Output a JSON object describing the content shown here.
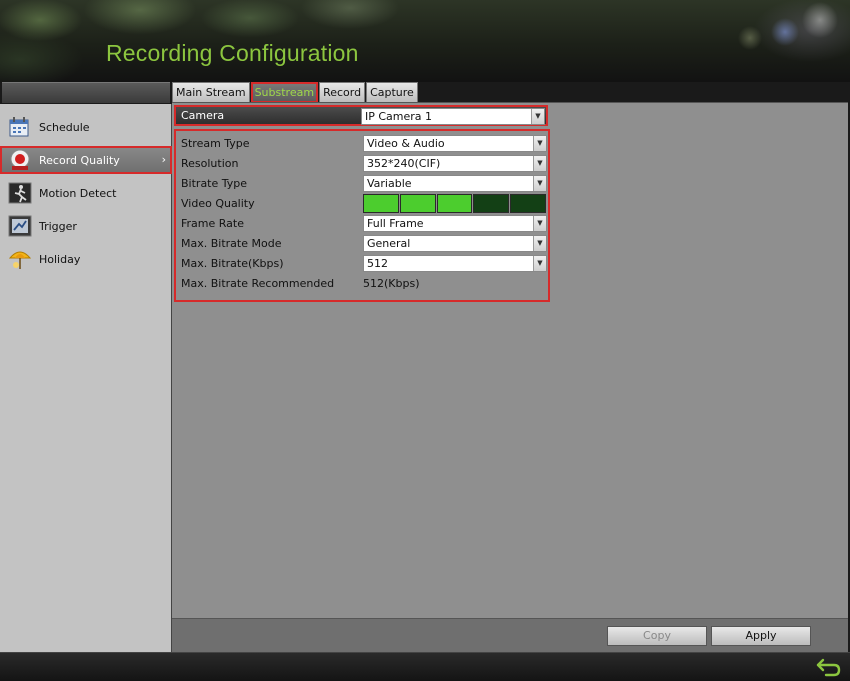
{
  "header": {
    "title": "Recording Configuration"
  },
  "tabs": [
    {
      "label": "Main Stream",
      "active": false
    },
    {
      "label": "Substream",
      "active": true
    },
    {
      "label": "Record",
      "active": false
    },
    {
      "label": "Capture",
      "active": false
    }
  ],
  "sidebar": {
    "items": [
      {
        "label": "Schedule",
        "icon": "calendar-icon",
        "active": false
      },
      {
        "label": "Record Quality",
        "icon": "record-icon",
        "active": true
      },
      {
        "label": "Motion Detect",
        "icon": "motion-icon",
        "active": false
      },
      {
        "label": "Trigger",
        "icon": "trigger-icon",
        "active": false
      },
      {
        "label": "Holiday",
        "icon": "holiday-icon",
        "active": false
      }
    ]
  },
  "camera": {
    "label": "Camera",
    "value": "IP Camera 1"
  },
  "settings": {
    "stream_type": {
      "label": "Stream Type",
      "value": "Video & Audio"
    },
    "resolution": {
      "label": "Resolution",
      "value": "352*240(CIF)"
    },
    "bitrate_type": {
      "label": "Bitrate Type",
      "value": "Variable"
    },
    "video_quality": {
      "label": "Video Quality",
      "level": 3,
      "max": 5
    },
    "frame_rate": {
      "label": "Frame Rate",
      "value": "Full Frame"
    },
    "max_bitrate_mode": {
      "label": "Max. Bitrate Mode",
      "value": "General"
    },
    "max_bitrate": {
      "label": "Max. Bitrate(Kbps)",
      "value": "512"
    },
    "max_bitrate_recommended": {
      "label": "Max. Bitrate Recommended",
      "value": "512(Kbps)"
    }
  },
  "buttons": {
    "copy": "Copy",
    "apply": "Apply"
  },
  "colors": {
    "accent_green": "#8cc63f",
    "highlight_red": "#d62a2a",
    "quality_on": "#4ccd2e",
    "quality_off": "#134015"
  }
}
